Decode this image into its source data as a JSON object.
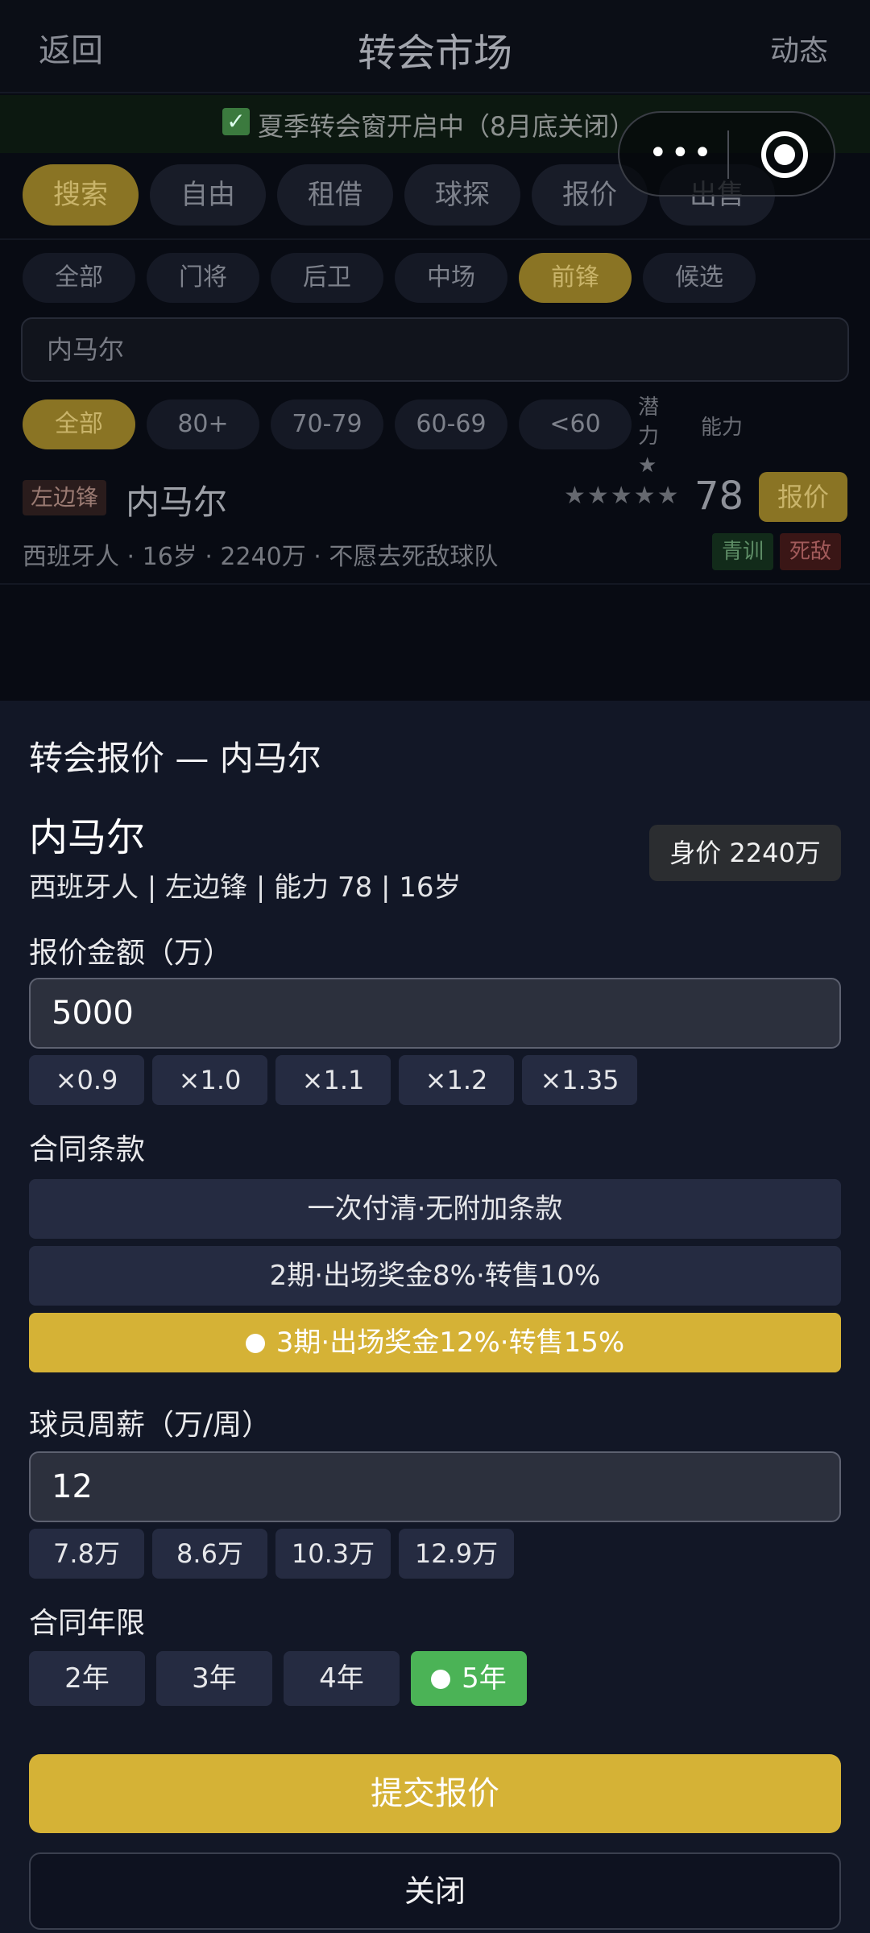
{
  "nav": {
    "back": "返回",
    "title": "转会市场",
    "right": "动态"
  },
  "banner": {
    "check": "✓",
    "text": "夏季转会窗开启中（8月底关闭）"
  },
  "capsule": {
    "more": "•••"
  },
  "tabs": [
    "搜索",
    "自由",
    "租借",
    "球探",
    "报价",
    "出售"
  ],
  "positions": [
    "全部",
    "门将",
    "后卫",
    "中场",
    "前锋",
    "候选"
  ],
  "search": {
    "value": "内马尔"
  },
  "rating_filters": [
    "全部",
    "80+",
    "70-79",
    "60-69",
    "<60"
  ],
  "rating_extra": {
    "potential": "潜力★",
    "ability": "能力"
  },
  "player": {
    "position": "左边锋",
    "name": "内马尔",
    "stars": "★★★★★",
    "rating": "78",
    "offer": "报价",
    "meta": "西班牙人 · 16岁 · 2240万 · 不愿去死敌球队",
    "tags": [
      "青训",
      "死敌"
    ]
  },
  "modal": {
    "title": "转会报价 — 内马尔",
    "name": "内马尔",
    "sub": "西班牙人 | 左边锋 | 能力 78 | 16岁",
    "value": "身价 2240万",
    "amount_label": "报价金额（万）",
    "amount_value": "5000",
    "multipliers": [
      "×0.9",
      "×1.0",
      "×1.1",
      "×1.2",
      "×1.35"
    ],
    "terms_label": "合同条款",
    "terms": [
      "一次付清·无附加条款",
      "2期·出场奖金8%·转售10%",
      "3期·出场奖金12%·转售15%"
    ],
    "wage_label": "球员周薪（万/周）",
    "wage_value": "12",
    "wage_options": [
      "7.8万",
      "8.6万",
      "10.3万",
      "12.9万"
    ],
    "years_label": "合同年限",
    "years": [
      "2年",
      "3年",
      "4年",
      "5年"
    ],
    "submit": "提交报价",
    "close": "关闭"
  },
  "colors": {
    "accent_gold": "#d5b236",
    "accent_green": "#4bb356",
    "panel": "#121726"
  }
}
